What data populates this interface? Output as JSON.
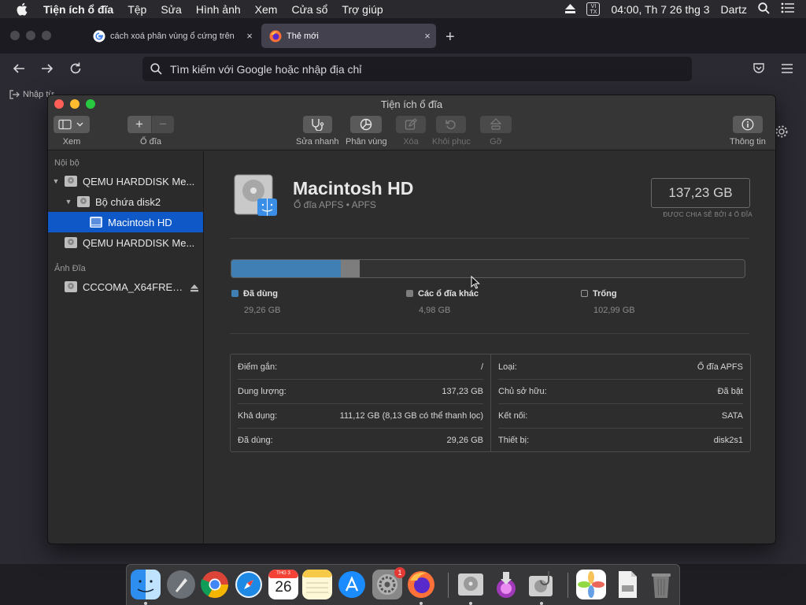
{
  "menubar": {
    "app_name": "Tiện ích ổ đĩa",
    "menus": [
      "Tệp",
      "Sửa",
      "Hình ảnh",
      "Xem",
      "Cửa sổ",
      "Trợ giúp"
    ],
    "input_badge_top": "VI",
    "input_badge_bottom": "TX",
    "clock": "04:00, Th 7 26 thg 3",
    "user": "Dartz"
  },
  "browser": {
    "tabs": [
      {
        "title": "cách xoá phân vùng ổ cứng trên",
        "close": "×"
      },
      {
        "title": "Thẻ mới",
        "close": "×"
      }
    ],
    "new_tab": "+",
    "url_placeholder": "Tìm kiếm với Google hoặc nhập địa chỉ",
    "bookmark_fragment": "Nhập từ"
  },
  "window": {
    "title": "Tiện ích ổ đĩa",
    "toolbar": {
      "view_label": "Xem",
      "disk_label": "Ổ đĩa",
      "add": "+",
      "remove": "−",
      "first_aid": "Sửa nhanh",
      "partition": "Phân vùng",
      "erase": "Xóa",
      "restore": "Khôi phục",
      "unmount": "Gỡ",
      "info": "Thông tin"
    },
    "sidebar": {
      "internal_header": "Nội bộ",
      "images_header": "Ảnh Đĩa",
      "items": [
        {
          "name": "QEMU HARDDISK Me...",
          "level": 0
        },
        {
          "name": "Bộ chứa disk2",
          "level": 1
        },
        {
          "name": "Macintosh HD",
          "level": 2
        },
        {
          "name": "QEMU HARDDISK Me...",
          "level": 0
        }
      ],
      "image_item": "CCCOMA_X64FRE_..."
    },
    "volume": {
      "name": "Macintosh HD",
      "subtitle": "Ổ đĩa APFS • APFS",
      "capacity": "137,23 GB",
      "capacity_note": "ĐƯỢC CHIA SẺ BỞI 4 Ổ ĐĨA"
    },
    "usage": {
      "segments": [
        {
          "label": "Đã dùng",
          "value": "29,26 GB",
          "fraction": 0.2132,
          "color": "#3f7fb3"
        },
        {
          "label": "Các ổ đĩa khác",
          "value": "4,98 GB",
          "fraction": 0.0363,
          "color": "#7d7d7d"
        },
        {
          "label": "Trống",
          "value": "102,99 GB",
          "fraction": 0.7505,
          "color": "#333333"
        }
      ]
    },
    "info_left": [
      {
        "key": "Điểm gắn:",
        "value": "/"
      },
      {
        "key": "Dung lượng:",
        "value": "137,23 GB"
      },
      {
        "key": "Khả dụng:",
        "value": "111,12 GB (8,13 GB có thể thanh lọc)"
      },
      {
        "key": "Đã dùng:",
        "value": "29,26 GB"
      }
    ],
    "info_right": [
      {
        "key": "Loại:",
        "value": "Ổ đĩa APFS"
      },
      {
        "key": "Chủ sở hữu:",
        "value": "Đã bật"
      },
      {
        "key": "Kết nối:",
        "value": "SATA"
      },
      {
        "key": "Thiết bị:",
        "value": "disk2s1"
      }
    ]
  },
  "dock": {
    "calendar_month": "THG 3",
    "calendar_day": "26",
    "system_prefs_badge": "1"
  }
}
